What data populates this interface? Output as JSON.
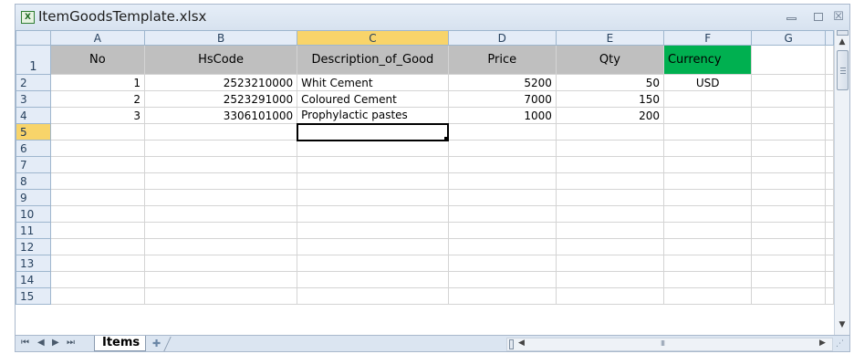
{
  "window": {
    "title": "ItemGoodsTemplate.xlsx",
    "icon": "excel-file-icon",
    "controls": [
      "minimize-icon",
      "restore-icon",
      "close-icon"
    ],
    "close_glyph": "☒"
  },
  "grid": {
    "column_letters": [
      "A",
      "B",
      "C",
      "D",
      "E",
      "F",
      "G"
    ],
    "selected_column": "C",
    "selected_row": 5,
    "active_cell": "C5",
    "row_numbers": [
      "1",
      "2",
      "3",
      "4",
      "5",
      "6",
      "7",
      "8",
      "9",
      "10",
      "11",
      "12",
      "13",
      "14",
      "15"
    ],
    "header_row": {
      "A": "No",
      "B": "HsCode",
      "C": "Description_of_Good",
      "D": "Price",
      "E": "Qty",
      "F": "Currency",
      "G": ""
    },
    "data_rows": [
      {
        "A": "1",
        "B": "2523210000",
        "C": "Whit Cement",
        "D": "5200",
        "E": "50",
        "F": "USD"
      },
      {
        "A": "2",
        "B": "2523291000",
        "C": "Coloured Cement",
        "D": "7000",
        "E": "150",
        "F": ""
      },
      {
        "A": "3",
        "B": "3306101000",
        "C": "Prophylactic pastes",
        "D": "1000",
        "E": "200",
        "F": ""
      }
    ],
    "colors": {
      "header_fill": "#bfbfbf",
      "currency_fill": "#00b050",
      "selection_highlight": "#f8d46a",
      "heading_fill": "#e4ecf7"
    }
  },
  "sheet_tabs": {
    "nav_glyphs": [
      "⏮",
      "◀",
      "▶",
      "⏭"
    ],
    "active_tab": "Items",
    "new_sheet_icon": "insert-worksheet-icon"
  },
  "scrollbars": {
    "h_thumb_glyph": "III"
  }
}
